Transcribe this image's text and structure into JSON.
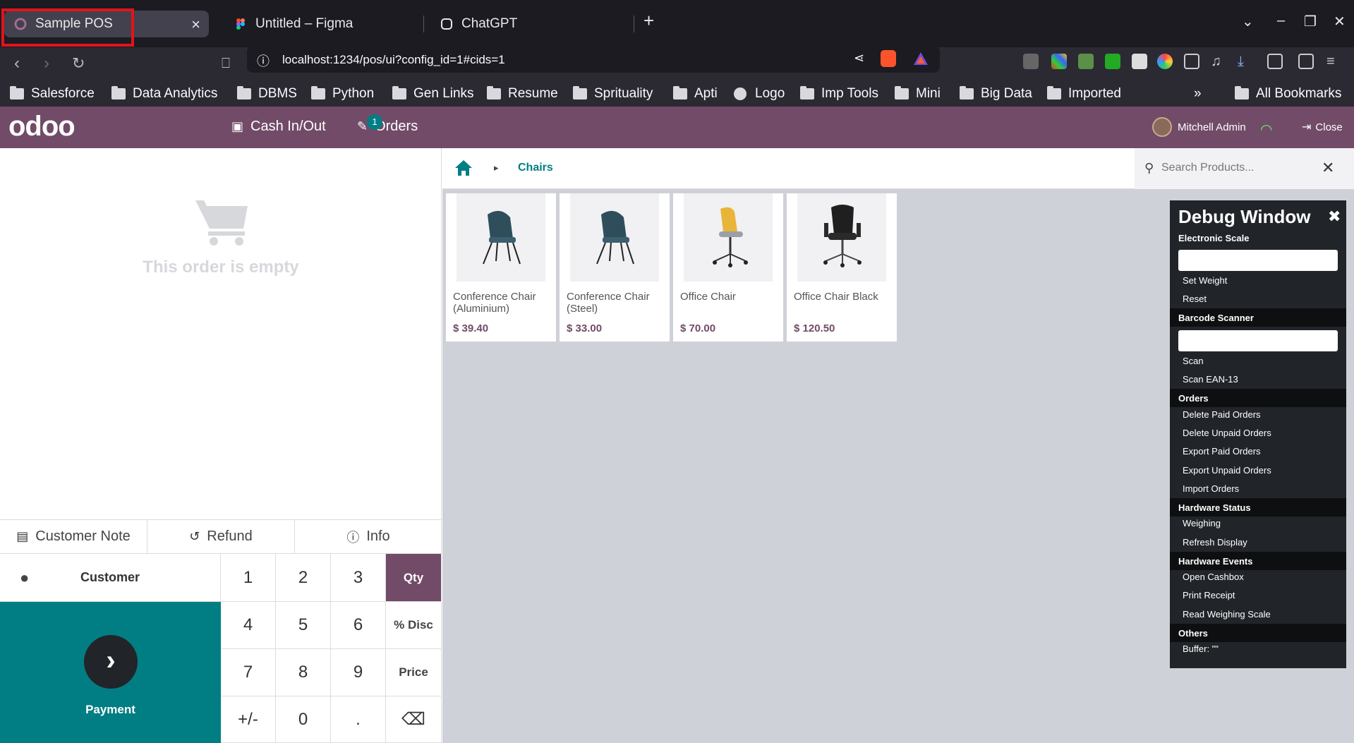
{
  "browser": {
    "tabs": [
      {
        "title": "Sample POS",
        "active": true
      },
      {
        "title": "Untitled – Figma",
        "active": false
      },
      {
        "title": "ChatGPT",
        "active": false
      }
    ],
    "url_host": "localhost",
    "url_rest": ":1234/pos/ui?config_id=1#cids=1",
    "bookmarks": [
      "Salesforce",
      "Data Analytics",
      "DBMS",
      "Python",
      "Gen Links",
      "Resume",
      "Sprituality",
      "Apti",
      "Logo",
      "Imp Tools",
      "Mini",
      "Big Data",
      "Imported"
    ],
    "all_bookmarks": "All Bookmarks",
    "overflow": "»"
  },
  "pos": {
    "logo": "odoo",
    "cash_in_out": "Cash In/Out",
    "orders": "Orders",
    "orders_count": "1",
    "user_name": "Mitchell Admin",
    "close": "Close"
  },
  "order": {
    "empty_text": "This order is empty",
    "customer_note": "Customer Note",
    "refund": "Refund",
    "info": "Info",
    "customer": "Customer",
    "payment": "Payment"
  },
  "numpad": {
    "keys": [
      "1",
      "2",
      "3",
      "Qty",
      "4",
      "5",
      "6",
      "% Disc",
      "7",
      "8",
      "9",
      "Price",
      "+/-",
      "0",
      ".",
      "⌫"
    ],
    "selected_mode": "Qty"
  },
  "products_panel": {
    "breadcrumb": "Chairs",
    "search_placeholder": "Search Products...",
    "products": [
      {
        "name": "Conference Chair (Aluminium)",
        "price": "$ 39.40"
      },
      {
        "name": "Conference Chair (Steel)",
        "price": "$ 33.00"
      },
      {
        "name": "Office Chair",
        "price": "$ 70.00"
      },
      {
        "name": "Office Chair Black",
        "price": "$ 120.50"
      }
    ]
  },
  "debug": {
    "title": "Debug Window",
    "electronic_scale": "Electronic Scale",
    "set_weight": "Set Weight",
    "reset": "Reset",
    "barcode_scanner": "Barcode Scanner",
    "scan": "Scan",
    "scan_ean": "Scan EAN-13",
    "orders": "Orders",
    "delete_paid": "Delete Paid Orders",
    "delete_unpaid": "Delete Unpaid Orders",
    "export_paid": "Export Paid Orders",
    "export_unpaid": "Export Unpaid Orders",
    "import_orders": "Import Orders",
    "hardware_status": "Hardware Status",
    "weighing": "Weighing",
    "refresh_display": "Refresh Display",
    "hardware_events": "Hardware Events",
    "open_cashbox": "Open Cashbox",
    "print_receipt": "Print Receipt",
    "read_scale": "Read Weighing Scale",
    "others": "Others",
    "buffer": "Buffer: \"\""
  },
  "colors": {
    "brand": "#714b67",
    "teal": "#017e84",
    "browser_bg": "#1c1b22"
  }
}
